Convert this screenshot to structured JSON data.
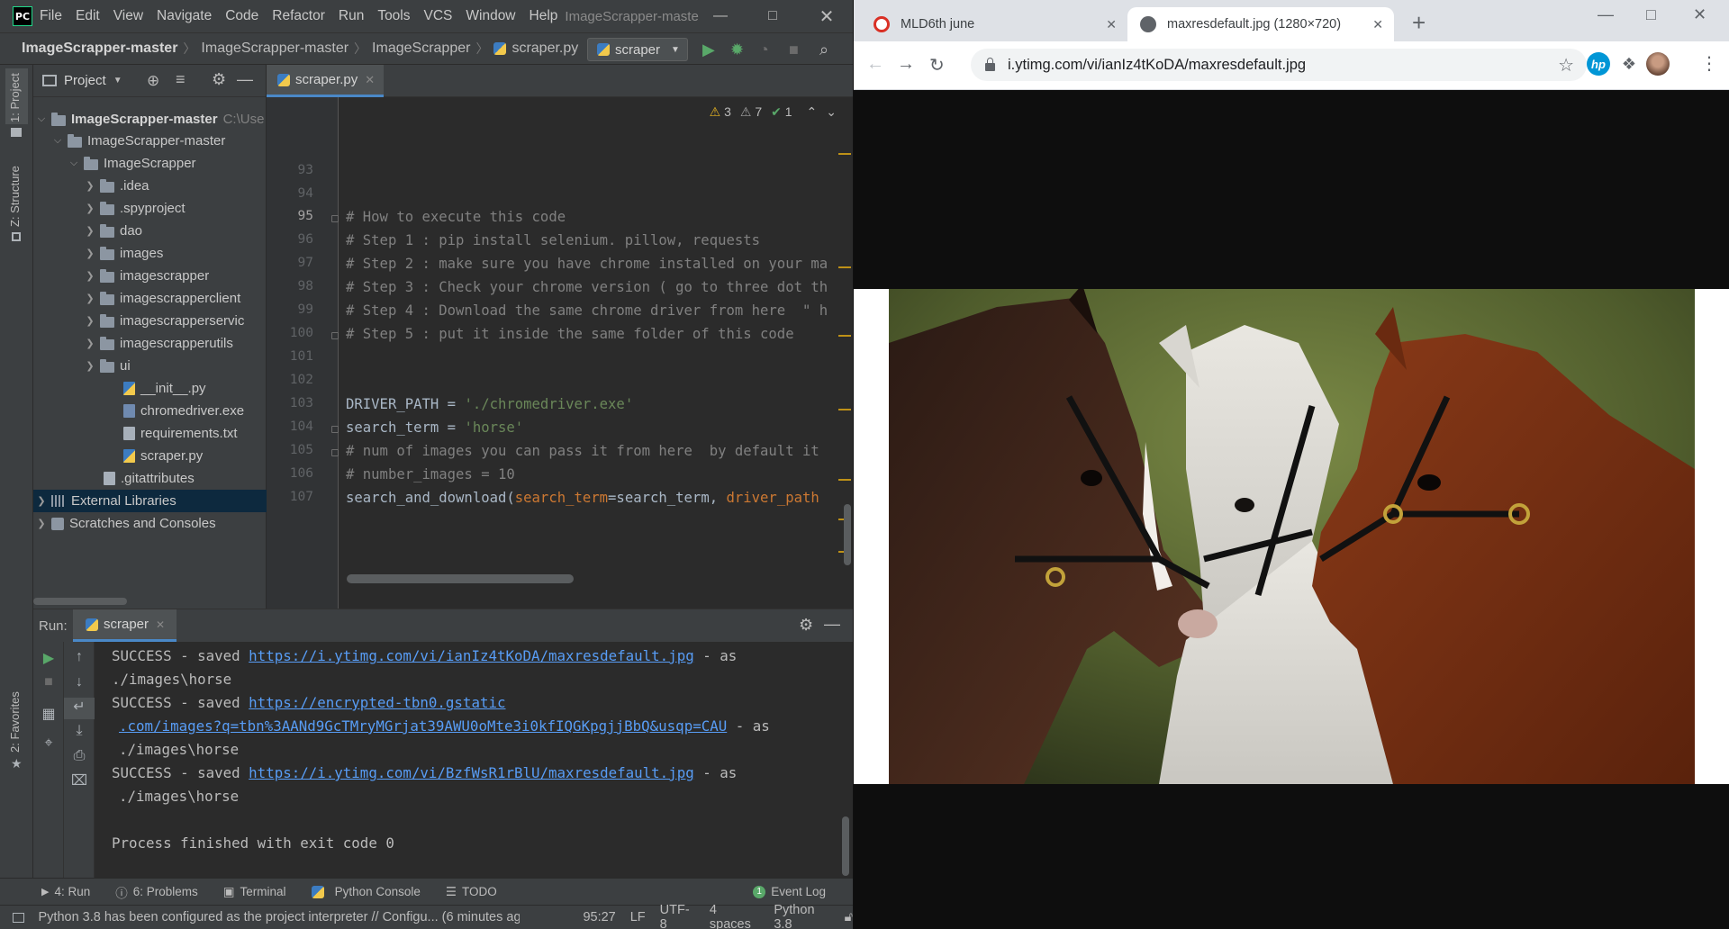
{
  "ide": {
    "logo": "PC",
    "menu": [
      "File",
      "Edit",
      "View",
      "Navigate",
      "Code",
      "Refactor",
      "Run",
      "Tools",
      "VCS",
      "Window",
      "Help"
    ],
    "window_title": "ImageScrapper-maste",
    "breadcrumbs": [
      "ImageScrapper-master",
      "ImageScrapper-master",
      "ImageScrapper",
      "scraper.py"
    ],
    "run_config": "scraper",
    "left_strip": {
      "project": "1: Project",
      "structure": "Z: Structure",
      "favorites": "2: Favorites"
    },
    "project": {
      "header": "Project",
      "root_name": "ImageScrapper-master",
      "root_path": "C:\\Use",
      "items": {
        "sub_root": "ImageScrapper-master",
        "pkg": "ImageScrapper",
        "idea": ".idea",
        "spyproject": ".spyproject",
        "dao": "dao",
        "images": "images",
        "imagescrapper": "imagescrapper",
        "client": "imagescrapperclient",
        "service": "imagescrapperservic",
        "utils": "imagescrapperutils",
        "ui": "ui",
        "init": "__init__.py",
        "chromedriver": "chromedriver.exe",
        "requirements": "requirements.txt",
        "scraper": "scraper.py",
        "gitattributes": ".gitattributes",
        "ext_libs": "External Libraries",
        "scratches": "Scratches and Consoles"
      }
    },
    "editor": {
      "tab": "scraper.py",
      "inspections": {
        "warnings": "3",
        "weak_warnings": "7",
        "ok": "1"
      },
      "line_numbers": [
        "93",
        "94",
        "95",
        "96",
        "97",
        "98",
        "99",
        "100",
        "101",
        "102",
        "103",
        "104",
        "105",
        "106",
        "107"
      ],
      "code": {
        "l95": "# How to execute this code",
        "l96": "# Step 1 : pip install selenium. pillow, requests",
        "l97": "# Step 2 : make sure you have chrome installed on your ma",
        "l98": "# Step 3 : Check your chrome version ( go to three dot th",
        "l99": "# Step 4 : Download the same chrome driver from here  \" h",
        "l100": "# Step 5 : put it inside the same folder of this code",
        "l103_var": "DRIVER_PATH = ",
        "l103_str": "'./chromedriver.exe'",
        "l104_var": "search_term = ",
        "l104_str": "'horse'",
        "l105": "# num of images you can pass it from here  by default it",
        "l106": "# number_images = 10",
        "l107_fn": "search_and_download(",
        "l107_kw1": "search_term",
        "l107_mid": "=search_term, ",
        "l107_kw2": "driver_path"
      }
    },
    "run": {
      "label": "Run:",
      "tab": "scraper",
      "lines": {
        "s1_pre": "SUCCESS - saved ",
        "s1_link": "https://i.ytimg.com/vi/ianIz4tKoDA/maxresdefault.jpg",
        "s1_post": " - as",
        "s1_path": "./images\\horse",
        "s2_pre": "SUCCESS - saved ",
        "s2_link1": "https://encrypted-tbn0.gstatic",
        "s2_link2": ".com/images?q=tbn%3AANd9GcTMryMGrjat39AWU0oMte3i0kfIQGKpgjjBbQ&usqp=CAU",
        "s2_post": " - as",
        "s2_path": "./images\\horse",
        "s3_pre": "SUCCESS - saved ",
        "s3_link": "https://i.ytimg.com/vi/BzfWsR1rBlU/maxresdefault.jpg",
        "s3_post": " - as",
        "s3_path": "./images\\horse",
        "exit": "Process finished with exit code 0"
      }
    },
    "bottom_tabs": [
      "4: Run",
      "6: Problems",
      "Terminal",
      "Python Console",
      "TODO",
      "Event Log"
    ],
    "status": {
      "message": "Python 3.8 has been configured as the project interpreter // Configu... (6 minutes ag",
      "position": "95:27",
      "line_sep": "LF",
      "encoding": "UTF-8",
      "indent": "4 spaces",
      "interpreter": "Python 3.8"
    }
  },
  "browser": {
    "tabs": [
      {
        "title": "MLD6th june",
        "active": false
      },
      {
        "title": "maxresdefault.jpg (1280×720)",
        "active": true
      }
    ],
    "url": "i.ytimg.com/vi/ianIz4tKoDA/maxresdefault.jpg",
    "extension_hp": "hp",
    "image_alt": "three horses (dark bay, white, chestnut) with bridles",
    "colors": {
      "accent": "#1a73e8",
      "ide_selection": "#0d293e",
      "pycharm_green": "#21d789"
    }
  }
}
